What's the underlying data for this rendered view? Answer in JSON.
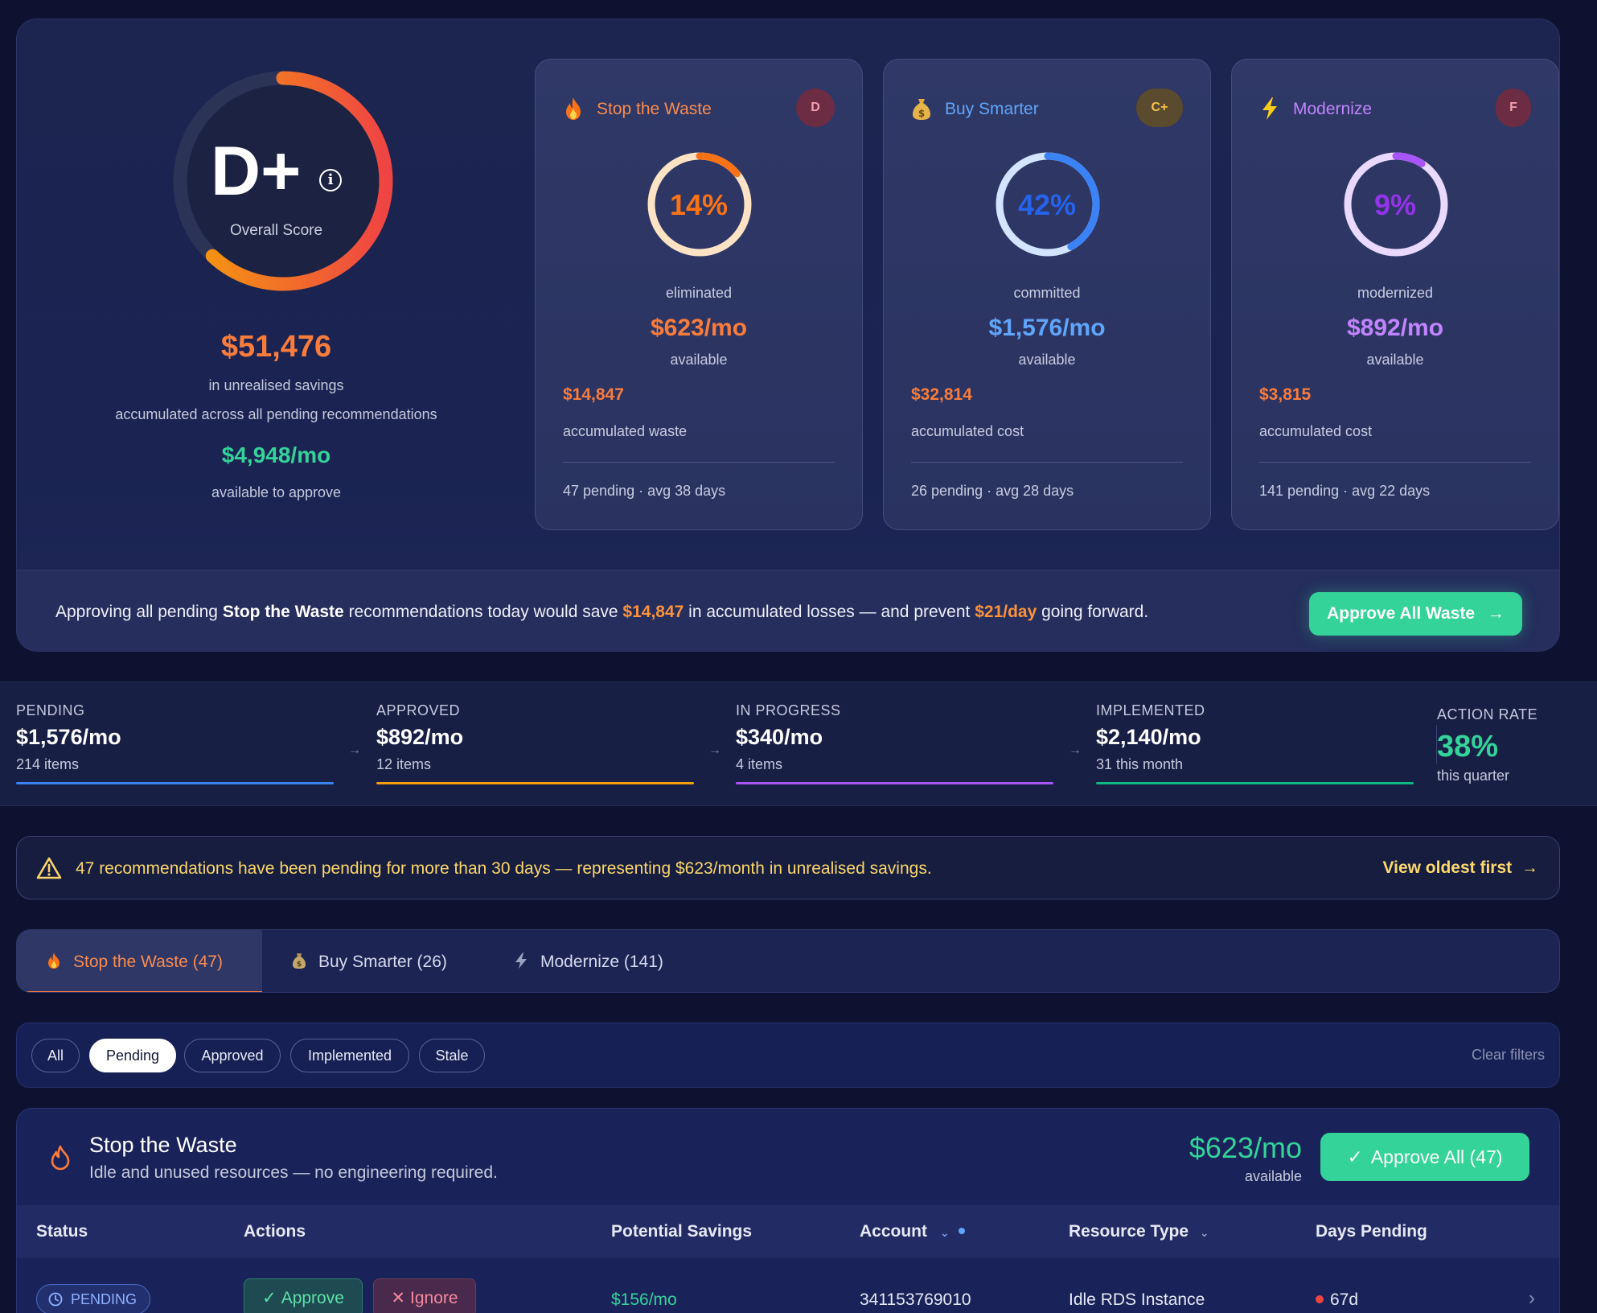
{
  "overall": {
    "grade": "D+",
    "score_label": "Overall Score",
    "score_fraction": 0.62,
    "total_savings": "$51,476",
    "savings_label": "in unrealised savings",
    "savings_note": "accumulated across all pending recommendations",
    "monthly": "$4,948/mo",
    "monthly_label": "available to approve"
  },
  "pillars": [
    {
      "title": "Stop the Waste",
      "icon": "fire-icon",
      "grade": "D",
      "percent": "14%",
      "percent_value": 14,
      "word": "eliminated",
      "rate": "$623/mo",
      "available": "available",
      "accumulated": "$14,847",
      "accumulated_label": "accumulated waste",
      "footer": "47 pending · avg 38 days",
      "accent": "#f97c3c"
    },
    {
      "title": "Buy Smarter",
      "icon": "money-bag-icon",
      "grade": "C+",
      "percent": "42%",
      "percent_value": 42,
      "word": "committed",
      "rate": "$1,576/mo",
      "available": "available",
      "accumulated": "$32,814",
      "accumulated_label": "accumulated cost",
      "footer": "26 pending · avg 28 days",
      "accent": "#3b82f6"
    },
    {
      "title": "Modernize",
      "icon": "lightning-icon",
      "grade": "F",
      "percent": "9%",
      "percent_value": 9,
      "word": "modernized",
      "rate": "$892/mo",
      "available": "available",
      "accumulated": "$3,815",
      "accumulated_label": "accumulated cost",
      "footer": "141 pending · avg 22 days",
      "accent": "#a855f7"
    }
  ],
  "banner": {
    "pre": "Approving all pending ",
    "bold": "Stop the Waste",
    "mid": " recommendations today would save ",
    "amount": "$14,847",
    "mid2": " in accumulated losses — and prevent ",
    "daily": "$21/day",
    "post": " going forward.",
    "button": "Approve All Waste"
  },
  "pipeline": {
    "stages": [
      {
        "label": "PENDING",
        "value": "$1,576/mo",
        "sub": "214 items",
        "color": "#3b82f6"
      },
      {
        "label": "APPROVED",
        "value": "$892/mo",
        "sub": "12 items",
        "color": "#f59e0b"
      },
      {
        "label": "IN PROGRESS",
        "value": "$340/mo",
        "sub": "4 items",
        "color": "#a855f7"
      },
      {
        "label": "IMPLEMENTED",
        "value": "$2,140/mo",
        "sub": "31 this month",
        "color": "#10b981"
      }
    ],
    "action_rate": {
      "label": "ACTION RATE",
      "value": "38%",
      "sub": "this quarter"
    }
  },
  "alert": {
    "message": "47 recommendations have been pending for more than 30 days — representing $623/month in unrealised savings.",
    "link": "View oldest first"
  },
  "tabs": [
    {
      "label": "Stop the Waste (47)",
      "icon": "fire-icon"
    },
    {
      "label": "Buy Smarter (26)",
      "icon": "money-bag-icon"
    },
    {
      "label": "Modernize (141)",
      "icon": "lightning-icon"
    }
  ],
  "filters": {
    "chips": [
      "All",
      "Pending",
      "Approved",
      "Implemented",
      "Stale"
    ],
    "active": "Pending",
    "clear": "Clear filters"
  },
  "section": {
    "title": "Stop the Waste",
    "description": "Idle and unused resources — no engineering required.",
    "amount": "$623/mo",
    "available": "available",
    "approve_all": "Approve All (47)",
    "columns": [
      "Status",
      "Actions",
      "Potential Savings",
      "Account",
      "Resource Type",
      "Days Pending"
    ],
    "rows": [
      {
        "status": "PENDING",
        "approve": "Approve",
        "ignore": "Ignore",
        "savings": "$156/mo",
        "account": "341153769010",
        "resource_type": "Idle RDS Instance",
        "days": "67d"
      }
    ]
  },
  "colors": {
    "green": "#34d399",
    "orange": "#f97c3c",
    "blue": "#3b82f6",
    "purple": "#a855f7",
    "amber": "#fbd56b"
  }
}
